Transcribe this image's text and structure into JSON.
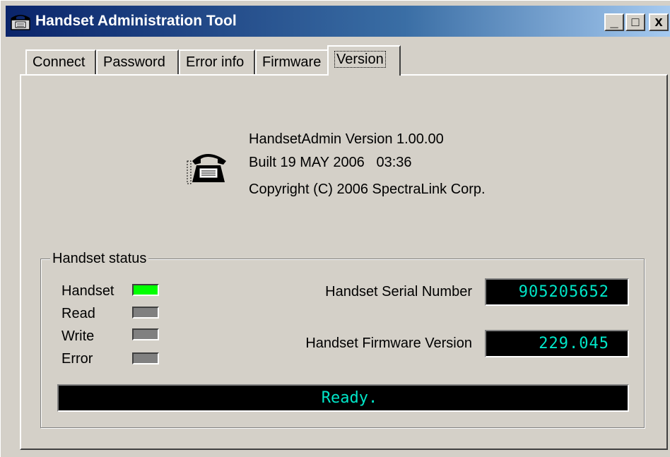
{
  "window": {
    "title": "Handset Administration Tool",
    "controls": {
      "minimize": "_",
      "maximize": "□",
      "close": "x"
    },
    "app_icon": "telephone-icon"
  },
  "tabs": [
    {
      "label": "Connect",
      "active": false
    },
    {
      "label": "Password",
      "active": false
    },
    {
      "label": "Error info",
      "active": false
    },
    {
      "label": "Firmware",
      "active": false
    },
    {
      "label": "Version",
      "active": true
    }
  ],
  "about": {
    "icon": "telephone-icon",
    "version": "HandsetAdmin Version 1.00.00",
    "built": "Built 19 MAY 2006   03:36",
    "copyright": "Copyright (C) 2006 SpectraLink Corp."
  },
  "status_group": {
    "title": "Handset status",
    "indicators": [
      {
        "label": "Handset",
        "on": true
      },
      {
        "label": "Read",
        "on": false
      },
      {
        "label": "Write",
        "on": false
      },
      {
        "label": "Error",
        "on": false
      }
    ],
    "serial_label": "Handset Serial Number",
    "serial_value": "905205652",
    "firmware_label": "Handset Firmware Version",
    "firmware_value": "229.045",
    "status_message": "Ready."
  },
  "colors": {
    "title_gradient_start": "#0a246a",
    "title_gradient_end": "#a6caf0",
    "face": "#d4d0c8",
    "led_on": "#00ff00",
    "led_off": "#808080",
    "lcd_background": "#000000",
    "lcd_text": "#00e6c8"
  }
}
